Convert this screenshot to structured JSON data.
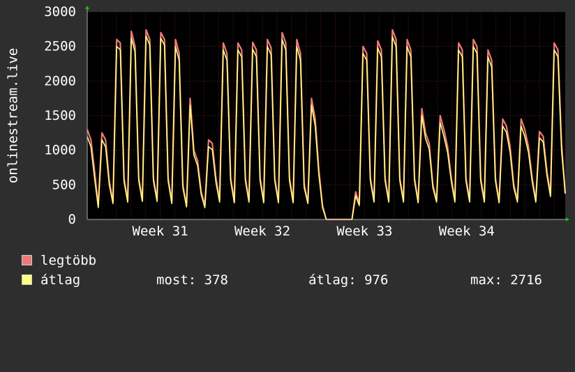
{
  "chart_data": {
    "type": "line",
    "ylabel": "onlinestream.live",
    "ylim": [
      0,
      3000
    ],
    "yticks": [
      0,
      500,
      1000,
      1500,
      2000,
      2500,
      3000
    ],
    "xticks": [
      "Week 31",
      "Week 32",
      "Week 33",
      "Week 34"
    ],
    "grid": true,
    "colors": {
      "background": "#2e2e2e",
      "plot": "#000000",
      "grid": "#5a2020",
      "max": "#f07a7a",
      "avg": "#ffff80",
      "axis": "#aaaaaa",
      "arrow": "#00cc00"
    },
    "samples_per_day": 4,
    "series": [
      {
        "name": "legtöbb",
        "values": [
          1300,
          1150,
          700,
          200,
          1250,
          1150,
          550,
          250,
          2600,
          2550,
          600,
          270,
          2720,
          2500,
          600,
          280,
          2740,
          2600,
          600,
          280,
          2700,
          2600,
          600,
          250,
          2600,
          2400,
          500,
          200,
          1750,
          1000,
          850,
          400,
          200,
          1150,
          1100,
          600,
          280,
          2550,
          2400,
          600,
          260,
          2550,
          2450,
          600,
          270,
          2560,
          2450,
          600,
          260,
          2600,
          2480,
          600,
          260,
          2700,
          2550,
          600,
          260,
          2600,
          2400,
          500,
          250,
          1750,
          1450,
          700,
          200,
          0,
          0,
          0,
          0,
          0,
          0,
          0,
          0,
          400,
          230,
          2500,
          2400,
          600,
          270,
          2580,
          2450,
          600,
          270,
          2740,
          2600,
          600,
          270,
          2600,
          2450,
          600,
          260,
          1600,
          1250,
          1100,
          500,
          280,
          1500,
          1300,
          1050,
          600,
          280,
          2550,
          2450,
          600,
          270,
          2600,
          2500,
          600,
          270,
          2450,
          2300,
          600,
          260,
          1450,
          1350,
          1050,
          500,
          280,
          1450,
          1300,
          1050,
          600,
          270,
          1270,
          1200,
          700,
          360,
          2550,
          2450,
          1100,
          370
        ]
      },
      {
        "name": "átlag",
        "values": [
          1200,
          1050,
          600,
          170,
          1150,
          1050,
          500,
          230,
          2500,
          2450,
          550,
          250,
          2620,
          2420,
          560,
          260,
          2650,
          2520,
          560,
          260,
          2620,
          2520,
          560,
          230,
          2500,
          2300,
          460,
          180,
          1650,
          930,
          780,
          360,
          170,
          1050,
          1010,
          540,
          250,
          2450,
          2300,
          560,
          240,
          2450,
          2350,
          560,
          250,
          2460,
          2350,
          560,
          240,
          2500,
          2380,
          560,
          240,
          2600,
          2450,
          560,
          240,
          2500,
          2300,
          460,
          230,
          1650,
          1350,
          640,
          170,
          0,
          0,
          0,
          0,
          0,
          0,
          0,
          0,
          340,
          200,
          2400,
          2300,
          560,
          250,
          2480,
          2350,
          560,
          250,
          2640,
          2500,
          560,
          250,
          2500,
          2350,
          560,
          240,
          1500,
          1170,
          1020,
          460,
          250,
          1400,
          1200,
          970,
          550,
          250,
          2450,
          2350,
          560,
          250,
          2500,
          2400,
          560,
          250,
          2350,
          2200,
          560,
          240,
          1350,
          1260,
          970,
          460,
          250,
          1350,
          1200,
          970,
          550,
          250,
          1180,
          1120,
          640,
          330,
          2450,
          2350,
          1000,
          378
        ]
      }
    ]
  },
  "legend": [
    {
      "label": "legtöbb",
      "color": "#f07a7a"
    },
    {
      "label": "átlag",
      "color": "#ffff80"
    }
  ],
  "stats": {
    "most": "most: 378",
    "atlag": "átlag: 976",
    "max": "max: 2716"
  }
}
